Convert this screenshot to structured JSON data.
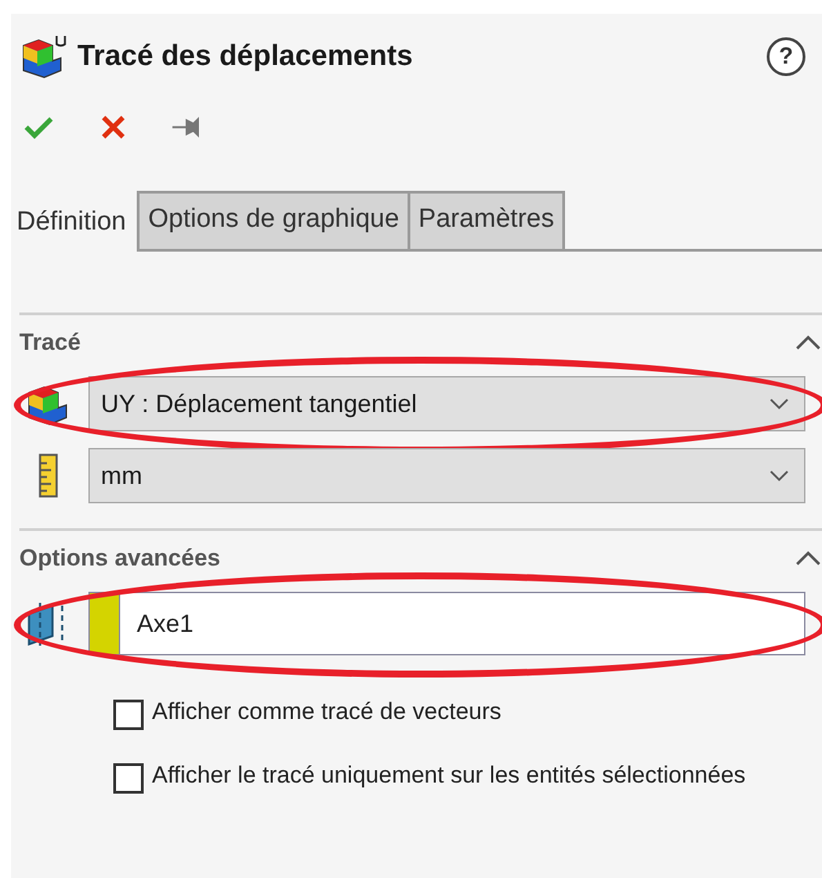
{
  "panel": {
    "title": "Tracé des déplacements",
    "help": "?"
  },
  "tabs": [
    {
      "label": "Définition",
      "selected": true
    },
    {
      "label": "Options de graphique",
      "selected": false
    },
    {
      "label": "Paramètres",
      "selected": false
    }
  ],
  "plot_section": {
    "heading": "Tracé",
    "expanded": true,
    "result": {
      "value": "UY : Déplacement tangentiel",
      "highlighted": true
    },
    "units": {
      "value": "mm"
    }
  },
  "advanced_section": {
    "heading": "Options avancées",
    "expanded": true,
    "reference": {
      "value": "Axe1",
      "color": "#d4d400",
      "highlighted": true
    },
    "options": [
      {
        "label": "Afficher comme tracé de vecteurs",
        "checked": false
      },
      {
        "label": "Afficher le tracé uniquement sur les entités sélectionnées",
        "checked": false
      }
    ]
  }
}
